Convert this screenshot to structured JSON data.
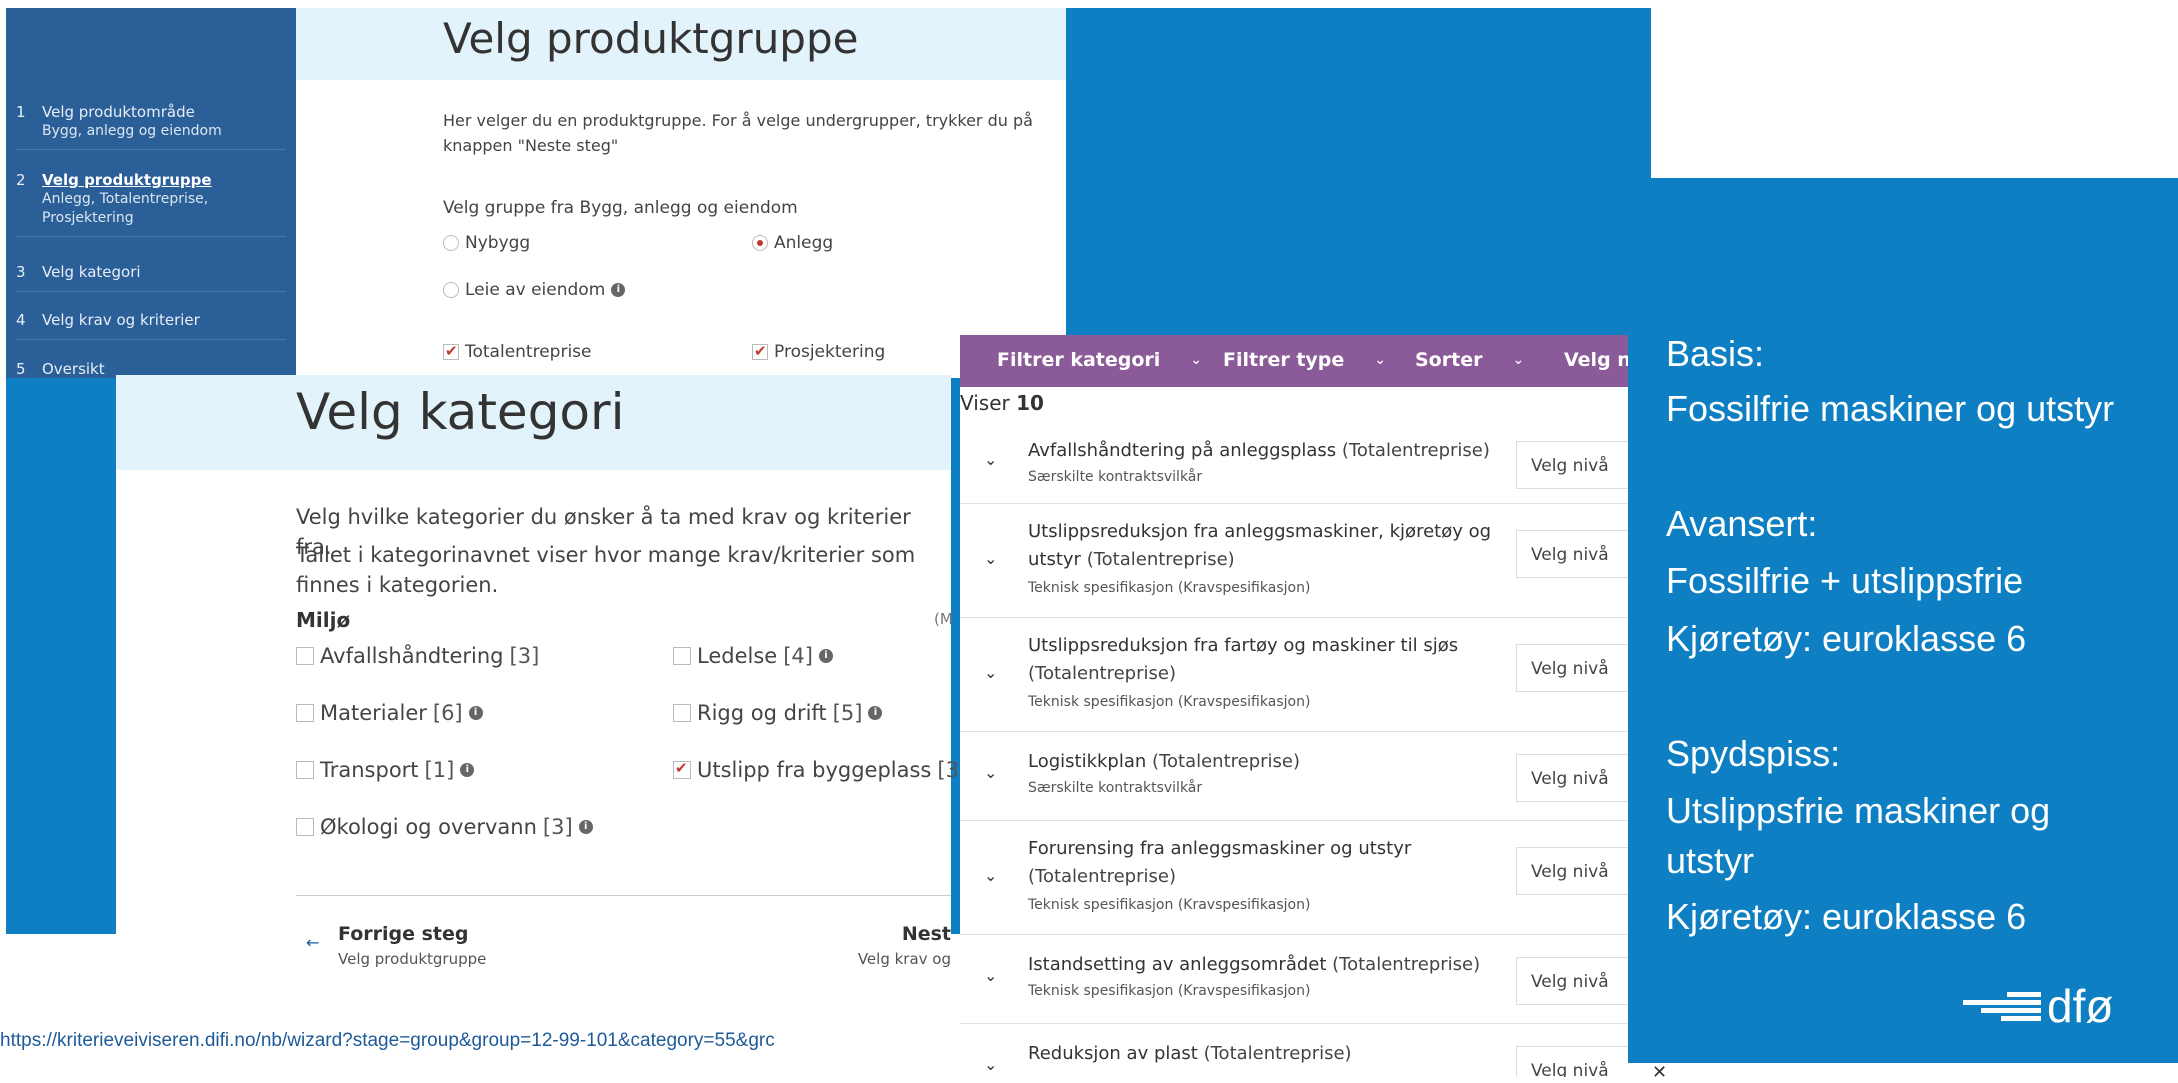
{
  "wizard": {
    "steps": [
      {
        "num": "1",
        "label": "Velg produktområde",
        "sub": "Bygg, anlegg og eiendom"
      },
      {
        "num": "2",
        "label": "Velg produktgruppe",
        "sub": "Anlegg, Totalentreprise, Prosjektering"
      },
      {
        "num": "3",
        "label": "Velg kategori",
        "sub": ""
      },
      {
        "num": "4",
        "label": "Velg krav og kriterier",
        "sub": ""
      },
      {
        "num": "5",
        "label": "Oversikt",
        "sub": ""
      }
    ],
    "title": "Velg produktgruppe",
    "intro": "Her velger du en produktgruppe. For å velge undergrupper, trykker du på knappen \"Neste steg\"",
    "group_label": "Velg gruppe fra Bygg, anlegg og eiendom",
    "options": {
      "nybygg": "Nybygg",
      "anlegg": "Anlegg",
      "leie": "Leie av eiendom"
    },
    "subs": {
      "totalentreprise": "Totalentreprise",
      "prosjektering": "Prosjektering"
    }
  },
  "kategori": {
    "title": "Velg kategori",
    "p1": "Velg hvilke kategorier du ønsker å ta med krav og kriterier fra.",
    "p2": "Tallet i kategorinavnet viser hvor mange krav/kriterier som finnes i kategorien.",
    "section": "Miljø",
    "section_right": "(M",
    "items": [
      {
        "label": "Avfallshåndtering",
        "count": "[3]"
      },
      {
        "label": "Ledelse",
        "count": "[4]"
      },
      {
        "label": "Materialer",
        "count": "[6]"
      },
      {
        "label": "Rigg og drift",
        "count": "[5]"
      },
      {
        "label": "Transport",
        "count": "[1]"
      },
      {
        "label": "Utslipp fra byggeplass",
        "count": "[3"
      },
      {
        "label": "Økologi og overvann",
        "count": "[3]"
      }
    ],
    "prev_title": "Forrige steg",
    "prev_sub": "Velg produktgruppe",
    "next_title": "Nest",
    "next_sub": "Velg krav og"
  },
  "url": "https://kriterieveiviseren.difi.no/nb/wizard?stage=group&group=12-99-101&category=55&grc",
  "filters": {
    "bar": [
      "Filtrer kategori",
      "Filtrer type",
      "Sorter",
      "Velg niv"
    ],
    "viser_label": "Viser",
    "viser_count": "10",
    "button_label": "Velg nivå",
    "rows": [
      {
        "title": "Avfallshåndtering på anleggsplass",
        "paren": "(Totalentreprise)",
        "sub": "Særskilte kontraktsvilkår"
      },
      {
        "title": "Utslippsreduksjon fra anleggsmaskiner, kjøretøy og utstyr",
        "paren": "(Totalentreprise)",
        "sub": "Teknisk spesifikasjon (Kravspesifikasjon)"
      },
      {
        "title": "Utslippsreduksjon fra fartøy og maskiner til sjøs",
        "paren": "(Totalentreprise)",
        "sub": "Teknisk spesifikasjon (Kravspesifikasjon)"
      },
      {
        "title": "Logistikkplan",
        "paren": "(Totalentreprise)",
        "sub": "Særskilte kontraktsvilkår"
      },
      {
        "title": "Forurensing fra anleggsmaskiner og utstyr",
        "paren": "(Totalentreprise)",
        "sub": "Teknisk spesifikasjon (Kravspesifikasjon)"
      },
      {
        "title": "Istandsetting av anleggsområdet",
        "paren": "(Totalentreprise)",
        "sub": "Teknisk spesifikasjon (Kravspesifikasjon)"
      },
      {
        "title": "Reduksjon av plast",
        "paren": "(Totalentreprise)",
        "sub": ""
      }
    ]
  },
  "levels": {
    "lines": [
      "Basis:",
      "Fossilfrie maskiner og utstyr",
      "Avansert:",
      "Fossilfrie + utslippsfrie",
      "Kjøretøy: euroklasse 6",
      "Spydspiss:",
      "Utslippsfrie maskiner og",
      "utstyr",
      "Kjøretøy: euroklasse 6"
    ],
    "logo_text": "dfø"
  },
  "close_glyph": "✕",
  "colors": {
    "blue": "#0e7fc2",
    "sidebar": "#2b5f98",
    "filterbar": "#8b5a98",
    "header_tint": "#e3f3fb",
    "accent": "#c0392b"
  }
}
